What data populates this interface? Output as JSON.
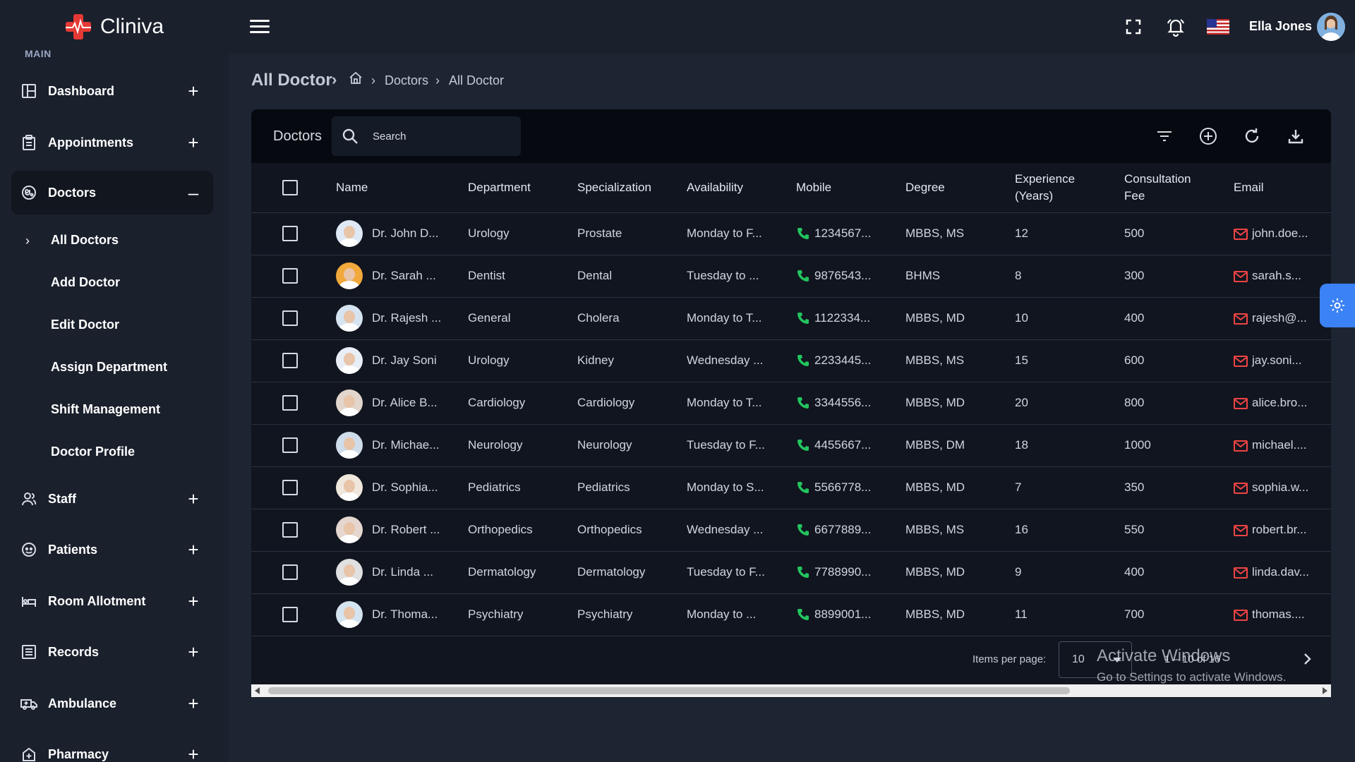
{
  "header": {
    "app_name": "Cliniva",
    "user_name": "Ella Jones"
  },
  "sidebar": {
    "section_label": "MAIN",
    "items": [
      {
        "label": "Dashboard",
        "sign": "+"
      },
      {
        "label": "Appointments",
        "sign": "+"
      },
      {
        "label": "Doctors",
        "sign": "–"
      },
      {
        "label": "Staff",
        "sign": "+"
      },
      {
        "label": "Patients",
        "sign": "+"
      },
      {
        "label": "Room Allotment",
        "sign": "+"
      },
      {
        "label": "Records",
        "sign": "+"
      },
      {
        "label": "Ambulance",
        "sign": "+"
      },
      {
        "label": "Pharmacy",
        "sign": "+"
      }
    ],
    "doctor_subitems": [
      "All Doctors",
      "Add Doctor",
      "Edit Doctor",
      "Assign Department",
      "Shift Management",
      "Doctor Profile"
    ]
  },
  "breadcrumb": {
    "title": "All Doctor",
    "crumb1": "Doctors",
    "crumb2": "All Doctor"
  },
  "card": {
    "title": "Doctors",
    "search_placeholder": "Search"
  },
  "table": {
    "columns": [
      "Name",
      "Department",
      "Specialization",
      "Availability",
      "Mobile",
      "Degree",
      "Experience (Years)",
      "Consultation Fee",
      "Email"
    ],
    "rows": [
      {
        "name": "Dr. John D...",
        "department": "Urology",
        "specialization": "Prostate",
        "availability": "Monday to F...",
        "mobile": "1234567...",
        "degree": "MBBS, MS",
        "experience": "12",
        "fee": "500",
        "email": "john.doe..."
      },
      {
        "name": "Dr. Sarah ...",
        "department": "Dentist",
        "specialization": "Dental",
        "availability": "Tuesday to ...",
        "mobile": "9876543...",
        "degree": "BHMS",
        "experience": "8",
        "fee": "300",
        "email": "sarah.s..."
      },
      {
        "name": "Dr. Rajesh ...",
        "department": "General",
        "specialization": "Cholera",
        "availability": "Monday to T...",
        "mobile": "1122334...",
        "degree": "MBBS, MD",
        "experience": "10",
        "fee": "400",
        "email": "rajesh@..."
      },
      {
        "name": "Dr. Jay Soni",
        "department": "Urology",
        "specialization": "Kidney",
        "availability": "Wednesday ...",
        "mobile": "2233445...",
        "degree": "MBBS, MS",
        "experience": "15",
        "fee": "600",
        "email": "jay.soni..."
      },
      {
        "name": "Dr. Alice B...",
        "department": "Cardiology",
        "specialization": "Cardiology",
        "availability": "Monday to T...",
        "mobile": "3344556...",
        "degree": "MBBS, MD",
        "experience": "20",
        "fee": "800",
        "email": "alice.bro..."
      },
      {
        "name": "Dr. Michae...",
        "department": "Neurology",
        "specialization": "Neurology",
        "availability": "Tuesday to F...",
        "mobile": "4455667...",
        "degree": "MBBS, DM",
        "experience": "18",
        "fee": "1000",
        "email": "michael...."
      },
      {
        "name": "Dr. Sophia...",
        "department": "Pediatrics",
        "specialization": "Pediatrics",
        "availability": "Monday to S...",
        "mobile": "5566778...",
        "degree": "MBBS, MD",
        "experience": "7",
        "fee": "350",
        "email": "sophia.w..."
      },
      {
        "name": "Dr. Robert ...",
        "department": "Orthopedics",
        "specialization": "Orthopedics",
        "availability": "Wednesday ...",
        "mobile": "6677889...",
        "degree": "MBBS, MS",
        "experience": "16",
        "fee": "550",
        "email": "robert.br..."
      },
      {
        "name": "Dr. Linda ...",
        "department": "Dermatology",
        "specialization": "Dermatology",
        "availability": "Tuesday to F...",
        "mobile": "7788990...",
        "degree": "MBBS, MD",
        "experience": "9",
        "fee": "400",
        "email": "linda.dav..."
      },
      {
        "name": "Dr. Thoma...",
        "department": "Psychiatry",
        "specialization": "Psychiatry",
        "availability": "Monday to ...",
        "mobile": "8899001...",
        "degree": "MBBS, MD",
        "experience": "11",
        "fee": "700",
        "email": "thomas...."
      }
    ]
  },
  "pager": {
    "items_label": "Items per page:",
    "page_size": "10",
    "range": "1 – 10 of 16"
  },
  "watermark": {
    "line1": "Activate Windows",
    "line2": "Go to Settings to activate Windows."
  },
  "colors": {
    "accent": "#3b82f6",
    "phone": "#22c55e",
    "mail": "#ef4444",
    "logo": "#e53935"
  }
}
